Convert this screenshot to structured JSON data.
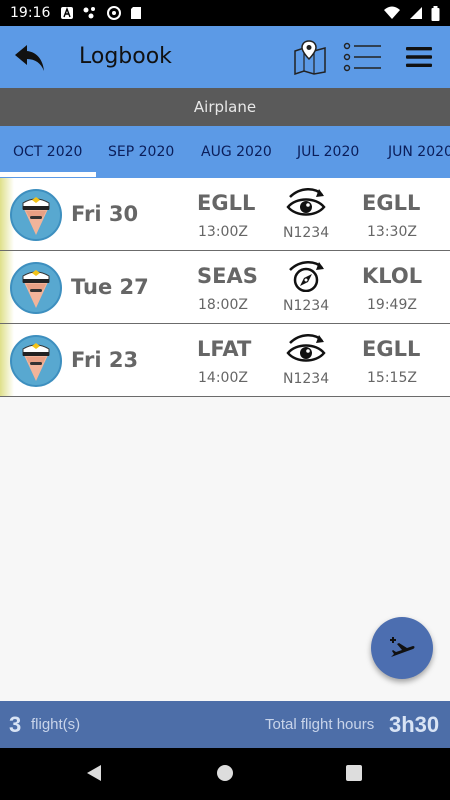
{
  "status_bar": {
    "time": "19:16"
  },
  "app_bar": {
    "title": "Logbook"
  },
  "subheader": {
    "label": "Airplane"
  },
  "tabs": [
    {
      "label": "OCT 2020",
      "active": true
    },
    {
      "label": "SEP 2020",
      "active": false
    },
    {
      "label": "AUG 2020",
      "active": false
    },
    {
      "label": "JUL 2020",
      "active": false
    },
    {
      "label": "JUN 2020",
      "active": false
    }
  ],
  "flights": [
    {
      "date": "Fri 30",
      "from": "EGLL",
      "dep_time": "13:00Z",
      "registration": "N1234",
      "to": "EGLL",
      "arr_time": "13:30Z",
      "mode_icon": "eye-arrow-icon"
    },
    {
      "date": "Tue 27",
      "from": "SEAS",
      "dep_time": "18:00Z",
      "registration": "N1234",
      "to": "KLOL",
      "arr_time": "19:49Z",
      "mode_icon": "compass-arrow-icon"
    },
    {
      "date": "Fri 23",
      "from": "LFAT",
      "dep_time": "14:00Z",
      "registration": "N1234",
      "to": "EGLL",
      "arr_time": "15:15Z",
      "mode_icon": "eye-arrow-icon"
    }
  ],
  "footer": {
    "flight_count": "3",
    "flight_count_label": "flight(s)",
    "hours_label": "Total flight hours",
    "hours_value": "3h30"
  },
  "colors": {
    "app_bar": "#5c9ae6",
    "subheader": "#5a5a5a",
    "footer": "#4d6ea8",
    "fab": "#4c6eb0"
  }
}
